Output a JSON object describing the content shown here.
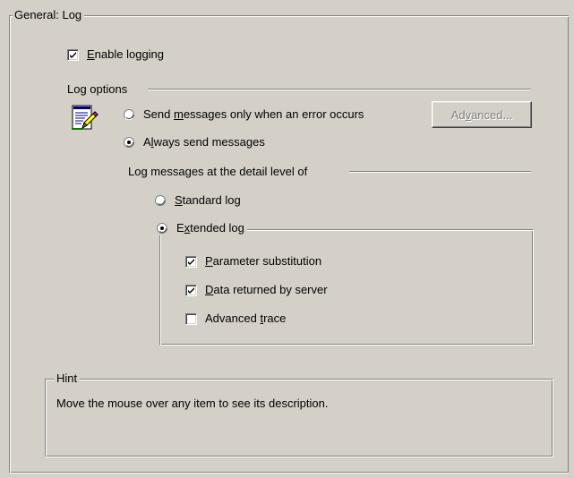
{
  "general": {
    "title": "General: Log",
    "enable_logging": {
      "pre": "",
      "key": "E",
      "post": "nable logging",
      "checked": true
    }
  },
  "log_options": {
    "title": "Log options",
    "send_on_error": {
      "pre": "Send ",
      "key": "m",
      "post": "essages only when an error occurs",
      "selected": false
    },
    "always_send": {
      "pre": "A",
      "key": "l",
      "post": "ways send messages",
      "selected": true
    },
    "advanced_button": {
      "pre": "Ad",
      "key": "v",
      "post": "anced...",
      "enabled": false
    }
  },
  "detail_level": {
    "title": "Log messages at the detail level of",
    "standard": {
      "pre": "",
      "key": "S",
      "post": "tandard log",
      "selected": false
    },
    "extended": {
      "pre": "E",
      "key": "x",
      "post": "tended log",
      "selected": true
    },
    "parameter_substitution": {
      "pre": "",
      "key": "P",
      "post": "arameter substitution",
      "checked": true
    },
    "data_returned": {
      "pre": "",
      "key": "D",
      "post": "ata returned by server",
      "checked": true
    },
    "advanced_trace": {
      "pre": "Advanced ",
      "key": "t",
      "post": "race",
      "checked": false
    }
  },
  "hint": {
    "title": "Hint",
    "text": "Move the mouse over any item to see its description."
  },
  "icons": {
    "log_options": "notepad-pencil-icon"
  }
}
